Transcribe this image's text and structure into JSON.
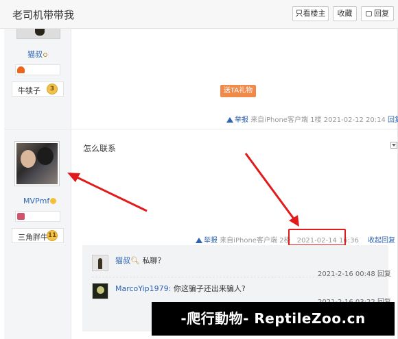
{
  "header": {
    "title": "老司机带带我",
    "buttons": {
      "only_op": "只看楼主",
      "favorite": "收藏",
      "reply": "回复"
    }
  },
  "post1": {
    "user": {
      "name": "猫叔",
      "level_title": "牛犊子",
      "level": "3"
    },
    "gift_button": "送TA礼物",
    "meta": {
      "report": "举报",
      "source": "来自iPhone客户端",
      "floor": "1楼",
      "time": "2021-02-12 20:14",
      "reply": "回复"
    }
  },
  "post2": {
    "user": {
      "name": "MVPmf",
      "level_title": "三角胖牛",
      "level": "11"
    },
    "content": "怎么联系",
    "meta": {
      "report": "举报",
      "source": "来自iPhone客户端",
      "floor": "2楼",
      "time": "2021-02-14 16:36",
      "collapse": "收起回复"
    },
    "comments": [
      {
        "user": "猫叔",
        "text": "私聊？",
        "time": "2021-2-16 00:48",
        "reply": "回复"
      },
      {
        "user": "MarcoYip1979",
        "text": "你这骗子还出来骗人?",
        "time": "2021-2-16 03:22",
        "reply": "回复"
      }
    ]
  },
  "watermark": "-爬行動物- ReptileZoo.cn",
  "colors": {
    "link": "#2d64b3",
    "gift": "#f08a4b",
    "highlight": "#e11b1b",
    "level_badge": "#f0c24b"
  }
}
